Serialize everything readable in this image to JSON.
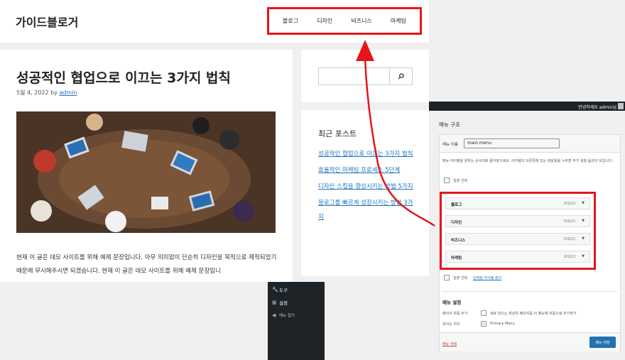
{
  "site": {
    "title": "가이드블로거",
    "nav": [
      "블로그",
      "디자인",
      "비즈니스",
      "마케팅"
    ]
  },
  "post": {
    "title": "성공적인 협업으로 이끄는 3가지 법칙",
    "date": "5월 4, 2022",
    "by": "by",
    "author": "admin",
    "body": "현재 이 글은 데모 사이트를 위해 예제 문장입니다. 아무 의미없이 단순히 디자인을 목적으로 제작되었기 때문에 무시해주시면 되겠습니다. 현재 이 글은 데모 사이트를 위해 예제 문장입니"
  },
  "sidebar": {
    "recent_title": "최근 포스트",
    "recent_posts": [
      "성공적인 협업으로 이끄는 3가지 법칙",
      "효율적인 마케팅 프로세스 5단계",
      "디자인 스킬을 향상시키는 방법 5가지",
      "블로그를 빠르게 성장시키는 방법 3가지"
    ]
  },
  "admin_menu": {
    "items": [
      "도구",
      "설정",
      "메뉴 접기"
    ]
  },
  "wp": {
    "howdy": "안녕하세요 admin님",
    "heading": "메뉴 구조",
    "menu_name_label": "메뉴 이름",
    "menu_name_value": "main menu",
    "description": "메뉴 아이템을 원하는 순서대로 끌어놓으세요. 아이템의 오른쪽에 있는 화살표를 누르면 추가 설정 옵션이 보입니다.",
    "bulk_select": "일괄 선택",
    "remove_selected": "선택된 아이템 제거",
    "menu_items": [
      {
        "label": "블로그",
        "type": "카테고리"
      },
      {
        "label": "디자인",
        "type": "카테고리"
      },
      {
        "label": "비즈니스",
        "type": "카테고리"
      },
      {
        "label": "마케팅",
        "type": "카테고리"
      }
    ],
    "settings_title": "메뉴 설정",
    "auto_add_key": "페이지 자동 추가",
    "auto_add_value": "새로 만드는 최상위 페이지를 이 메뉴에 자동으로 추가하기",
    "location_key": "보이는 위치",
    "location_value": "Primary Menu",
    "delete_menu": "메뉴 삭제",
    "save_menu": "메뉴 저장"
  },
  "colors": {
    "highlight": "#e4161c",
    "link": "#1e73be",
    "wp_primary": "#2271b1"
  }
}
